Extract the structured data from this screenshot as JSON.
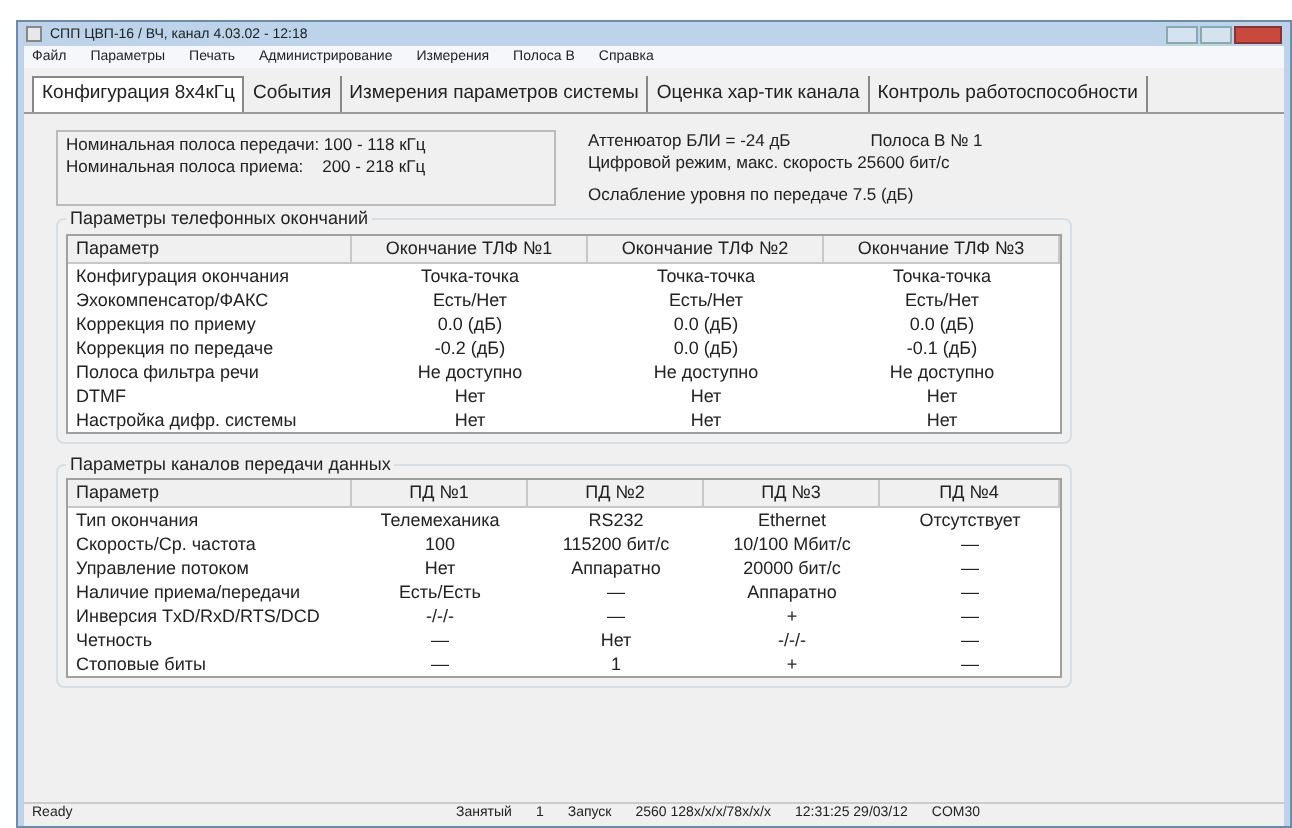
{
  "window": {
    "title": "СПП ЦВП-16 / ВЧ, канал 4.03.02 - 12:18"
  },
  "menu": [
    "Файл",
    "Параметры",
    "Печать",
    "Администрирование",
    "Измерения",
    "Полоса В",
    "Справка"
  ],
  "tabs": [
    {
      "label": "Конфигурация 8х4кГц",
      "selected": true
    },
    {
      "label": "События",
      "selected": false
    },
    {
      "label": "Измерения параметров системы",
      "selected": false
    },
    {
      "label": "Оценка хар-тик канала",
      "selected": false
    },
    {
      "label": "Контроль работоспособности",
      "selected": false
    }
  ],
  "bands": [
    "Номинальная полоса передачи: 100 - 118 кГц",
    "Номинальная полоса приема:    200 - 218 кГц"
  ],
  "info": {
    "attenuator": "Аттенюатор БЛИ = -24 дБ",
    "band": "Полоса В № 1",
    "digital": "Цифровой режим, макс. скорость 25600 бит/с",
    "attenuation": "Ослабление уровня по передаче 7.5 (дБ)"
  },
  "phone_table": {
    "title": "Параметры телефонных окончаний",
    "columns": [
      "Параметр",
      "Окончание ТЛФ №1",
      "Окончание ТЛФ №2",
      "Окончание ТЛФ №3"
    ],
    "rows": [
      [
        "Конфигурация окончания",
        "Точка-точка",
        "Точка-точка",
        "Точка-точка"
      ],
      [
        "Эхокомпенсатор/ФАКС",
        "Есть/Нет",
        "Есть/Нет",
        "Есть/Нет"
      ],
      [
        "Коррекция по приему",
        "0.0 (дБ)",
        "0.0 (дБ)",
        "0.0 (дБ)"
      ],
      [
        "Коррекция по передаче",
        "-0.2 (дБ)",
        "0.0 (дБ)",
        "-0.1 (дБ)"
      ],
      [
        "Полоса фильтра речи",
        "Не доступно",
        "Не доступно",
        "Не доступно"
      ],
      [
        "DTMF",
        "Нет",
        "Нет",
        "Нет"
      ],
      [
        "Настройка дифр. системы",
        "Нет",
        "Нет",
        "Нет"
      ]
    ]
  },
  "data_table": {
    "title": "Параметры каналов передачи данных",
    "columns": [
      "Параметр",
      "ПД №1",
      "ПД №2",
      "ПД №3",
      "ПД №4"
    ],
    "rows": [
      [
        "Тип окончания",
        "Телемеханика",
        "RS232",
        "Ethernet",
        "Отсутствует"
      ],
      [
        "Скорость/Ср. частота",
        "100",
        "115200 бит/с",
        "10/100 Мбит/с",
        "—"
      ],
      [
        "Управление потоком",
        "Нет",
        "Аппаратно",
        "20000 бит/с",
        "—"
      ],
      [
        "Наличие приема/передачи",
        "Есть/Есть",
        "—",
        "Аппаратно",
        "—"
      ],
      [
        "Инверсия TxD/RxD/RTS/DCD",
        "-/-/-",
        "—",
        "+",
        "—"
      ],
      [
        "Четность",
        "—",
        "Нет",
        "-/-/-",
        "—"
      ],
      [
        "Стоповые биты",
        "—",
        "1",
        "+",
        "—"
      ]
    ]
  },
  "status_bar": [
    "Ready",
    "Занятый",
    "1",
    "Запуск",
    "2560 128x/x/x/78x/x/x",
    "12:31:25 29/03/12",
    "COM30"
  ]
}
